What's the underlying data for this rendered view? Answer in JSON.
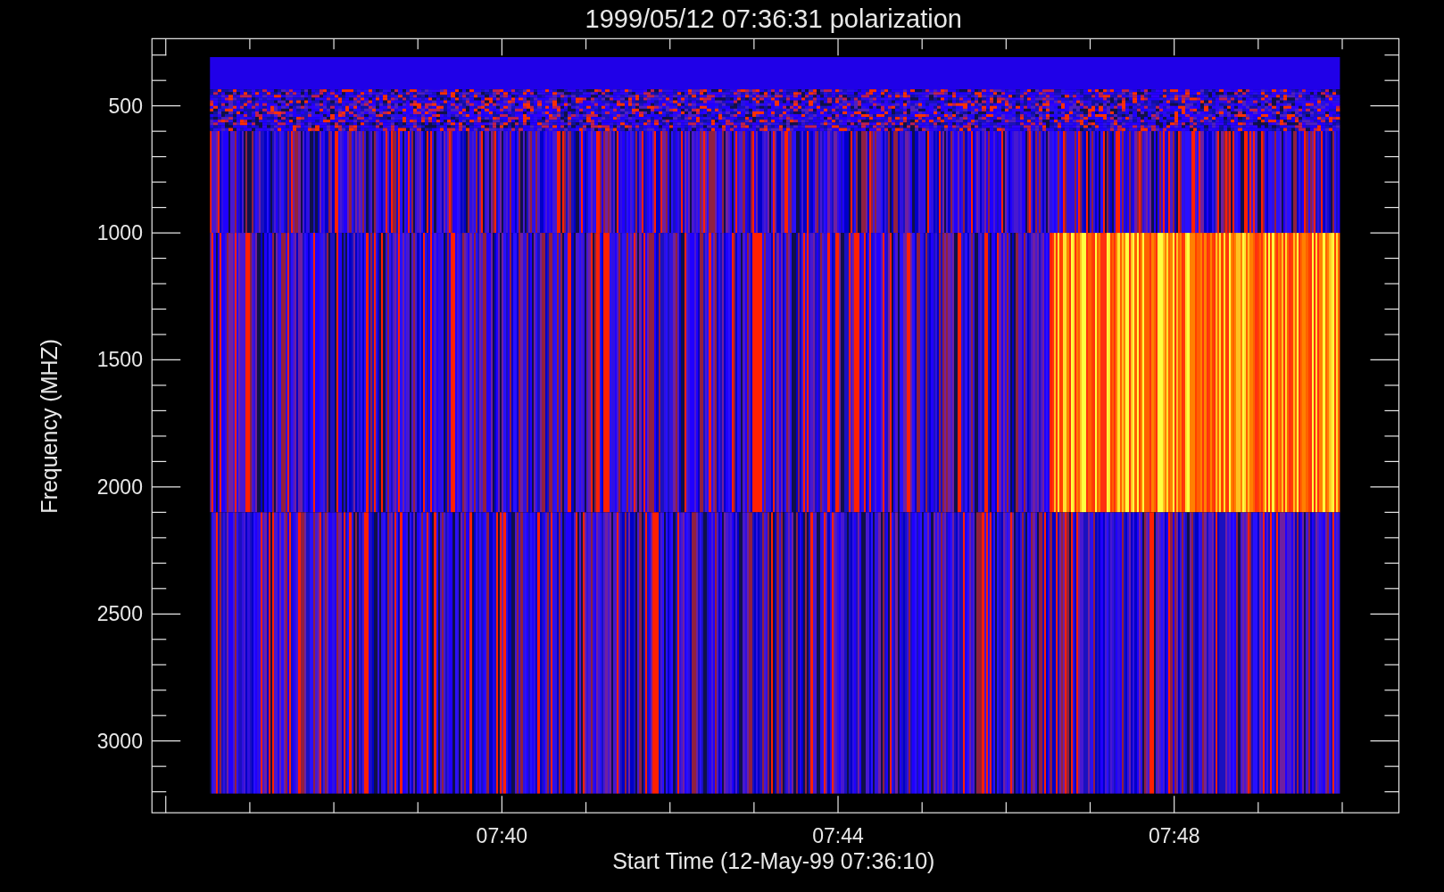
{
  "title": "1999/05/12 07:36:31 polarization",
  "y_axis": {
    "label": "Frequency (MHZ)",
    "ticks": [
      "500",
      "1000",
      "1500",
      "2000",
      "2500",
      "3000"
    ]
  },
  "x_axis": {
    "label": "Start Time (12-May-99 07:36:10)",
    "ticks": [
      "07:40",
      "07:44",
      "07:48"
    ]
  }
}
